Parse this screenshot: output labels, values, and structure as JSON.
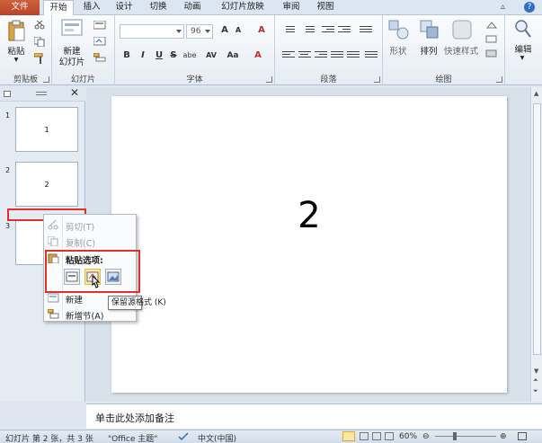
{
  "tabs": {
    "file": "文件",
    "home": "开始",
    "insert": "插入",
    "design": "设计",
    "transitions": "切换",
    "animations": "动画",
    "slideshow": "幻灯片放映",
    "review": "审阅",
    "view": "视图"
  },
  "ribbon": {
    "clipboard": {
      "label": "剪贴板",
      "paste": "粘贴"
    },
    "slides": {
      "label": "幻灯片",
      "new_slide_1": "新建",
      "new_slide_2": "幻灯片"
    },
    "font": {
      "label": "字体",
      "font_name": "",
      "font_size": "96",
      "bold": "B",
      "italic": "I",
      "underline": "U",
      "strike": "S",
      "shadow": "abe",
      "spacing": "AV",
      "case": "Aa",
      "grow": "A",
      "shrink": "A",
      "clear": "A"
    },
    "paragraph": {
      "label": "段落"
    },
    "drawing": {
      "label": "绘图",
      "shapes": "形状",
      "arrange": "排列",
      "quick_styles": "快速样式"
    },
    "editing": {
      "label": "编辑"
    }
  },
  "slides_panel": {
    "thumbnails": [
      {
        "number": "1",
        "content": "1"
      },
      {
        "number": "2",
        "content": "2"
      },
      {
        "number": "3",
        "content": ""
      }
    ]
  },
  "slide": {
    "content": "2"
  },
  "notes": {
    "placeholder": "单击此处添加备注"
  },
  "context_menu": {
    "cut": "剪切(T)",
    "copy": "复制(C)",
    "paste_options": "粘贴选项:",
    "new_slide": "新建",
    "new_section": "新增节(A)"
  },
  "tooltip": {
    "text": "保留源格式 (K)"
  },
  "status": {
    "slide_info": "幻灯片 第 2 张，共 3 张",
    "theme": "\"Office 主题\"",
    "language": "中文(中国)",
    "zoom": "60%"
  }
}
